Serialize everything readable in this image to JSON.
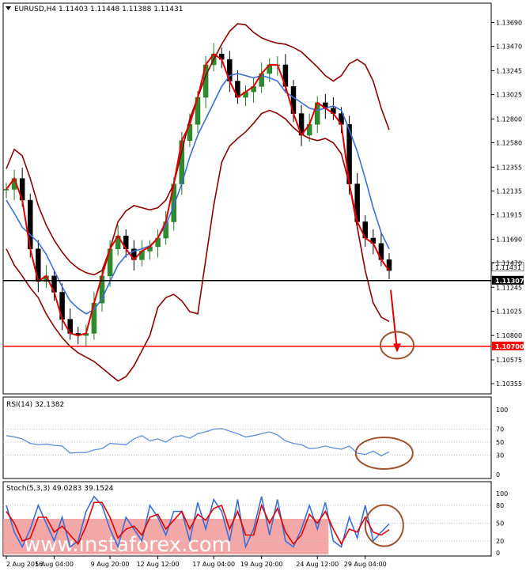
{
  "main_header": "EURUSD,H4  1.11403 1.11448 1.11388 1.11431",
  "rsi_header": "RSI(14) 32.1382",
  "stoch_header": "Stoch(5,3,3) 49.0283 39.1524",
  "watermark": "www.instaforex.com",
  "chart_data": [
    {
      "type": "line",
      "panel": "price",
      "symbol": "EURUSD",
      "timeframe": "H4",
      "ohlc": {
        "open": 1.11403,
        "high": 1.11448,
        "low": 1.11388,
        "close": 1.11431
      },
      "y_ticks": [
        "1.13690",
        "1.13470",
        "1.13245",
        "1.13025",
        "1.12800",
        "1.12580",
        "1.12355",
        "1.12135",
        "1.11915",
        "1.11690",
        "1.11470",
        "1.11245",
        "1.11025",
        "1.10800",
        "1.10575",
        "1.10355"
      ],
      "ylim": [
        1.1029,
        1.1376
      ],
      "x_ticks": [
        "2 Aug 2016",
        "5 Aug 04:00",
        "9 Aug 20:00",
        "12 Aug 12:00",
        "17 Aug 04:00",
        "19 Aug 20:00",
        "24 Aug 12:00",
        "29 Aug 04:00"
      ],
      "horizontal_lines": [
        {
          "value": 1.11307,
          "label": "1.11307",
          "color": "#000000"
        },
        {
          "value": 1.107,
          "label": "1.10700",
          "color": "#ff0000"
        }
      ],
      "current_price": {
        "value": 1.11431,
        "label": "1.11431"
      },
      "series": [
        {
          "role": "bollinger-upper",
          "color": "#8b0000",
          "values": [
            1.1234,
            1.1252,
            1.1246,
            1.1225,
            1.12,
            1.1182,
            1.1168,
            1.1157,
            1.1148,
            1.1142,
            1.1138,
            1.1136,
            1.114,
            1.116,
            1.1185,
            1.1195,
            1.12,
            1.1198,
            1.1196,
            1.1198,
            1.1205,
            1.122,
            1.125,
            1.128,
            1.13,
            1.132,
            1.1335,
            1.1349,
            1.1361,
            1.1368,
            1.1367,
            1.136,
            1.1355,
            1.1352,
            1.135,
            1.1349,
            1.1346,
            1.1342,
            1.1335,
            1.1328,
            1.132,
            1.1315,
            1.132,
            1.1331,
            1.1335,
            1.133,
            1.1315,
            1.129,
            1.127
          ]
        },
        {
          "role": "bollinger-middle",
          "color": "#3a6fd8",
          "values": [
            1.1205,
            1.1193,
            1.118,
            1.1173,
            1.1166,
            1.1155,
            1.114,
            1.1125,
            1.1112,
            1.1105,
            1.11,
            1.1104,
            1.1114,
            1.113,
            1.1145,
            1.1154,
            1.1158,
            1.116,
            1.1163,
            1.117,
            1.1182,
            1.12,
            1.122,
            1.1245,
            1.1265,
            1.128,
            1.1295,
            1.131,
            1.132,
            1.1322,
            1.132,
            1.1318,
            1.132,
            1.1318,
            1.1315,
            1.1305,
            1.13,
            1.1295,
            1.129,
            1.1288,
            1.129,
            1.1292,
            1.1288,
            1.127,
            1.125,
            1.1225,
            1.1198,
            1.1175,
            1.116
          ]
        },
        {
          "role": "bollinger-lower",
          "color": "#8b0000",
          "values": [
            1.116,
            1.1145,
            1.1135,
            1.1124,
            1.1115,
            1.11,
            1.1088,
            1.1078,
            1.107,
            1.1064,
            1.106,
            1.1056,
            1.105,
            1.1044,
            1.1038,
            1.1042,
            1.1052,
            1.1066,
            1.108,
            1.1106,
            1.1115,
            1.1118,
            1.1112,
            1.1102,
            1.11,
            1.115,
            1.12,
            1.124,
            1.1255,
            1.1262,
            1.1268,
            1.1276,
            1.1285,
            1.1288,
            1.1285,
            1.128,
            1.1272,
            1.1266,
            1.1262,
            1.126,
            1.1262,
            1.1258,
            1.1248,
            1.122,
            1.118,
            1.114,
            1.111,
            1.1097,
            1.1093
          ]
        },
        {
          "role": "moving-average",
          "color": "#e00000",
          "values": [
            1.1215,
            1.1225,
            1.1205,
            1.116,
            1.113,
            1.1135,
            1.112,
            1.1095,
            1.1082,
            1.108,
            1.1082,
            1.111,
            1.1135,
            1.116,
            1.1172,
            1.116,
            1.115,
            1.1158,
            1.1162,
            1.117,
            1.1185,
            1.122,
            1.126,
            1.1275,
            1.13,
            1.133,
            1.134,
            1.1335,
            1.1315,
            1.13,
            1.1305,
            1.131,
            1.1322,
            1.133,
            1.133,
            1.131,
            1.1285,
            1.1265,
            1.1275,
            1.1295,
            1.129,
            1.1285,
            1.1275,
            1.122,
            1.1185,
            1.117,
            1.1165,
            1.115,
            1.114
          ]
        },
        {
          "role": "forecast-arrow",
          "color": "#e00000",
          "from": {
            "index": 48,
            "value": 1.1122
          },
          "to": {
            "index": 49,
            "value": 1.1066
          }
        }
      ]
    },
    {
      "type": "line",
      "panel": "rsi",
      "name": "RSI(14)",
      "value": 32.1382,
      "ylim": [
        0,
        100
      ],
      "y_ticks": [
        100,
        70,
        50,
        30,
        0
      ],
      "color": "#5b8fd6",
      "values": [
        60,
        58,
        55,
        48,
        46,
        47,
        45,
        44,
        33,
        34,
        34,
        38,
        40,
        48,
        47,
        46,
        55,
        60,
        52,
        55,
        50,
        58,
        60,
        56,
        63,
        66,
        70,
        71,
        67,
        63,
        58,
        60,
        63,
        66,
        61,
        52,
        48,
        46,
        40,
        41,
        44,
        41,
        39,
        44,
        33,
        31,
        36,
        29,
        35
      ]
    },
    {
      "type": "line",
      "panel": "stochastic",
      "name": "Stoch(5,3,3)",
      "main_value": 49.0283,
      "signal_value": 39.1524,
      "ylim": [
        0,
        100
      ],
      "y_ticks": [
        100,
        80,
        50,
        20,
        0
      ],
      "series": [
        {
          "role": "main",
          "color": "#3a6fd8",
          "values": [
            80,
            35,
            10,
            40,
            80,
            50,
            20,
            60,
            10,
            20,
            70,
            95,
            80,
            40,
            10,
            60,
            40,
            20,
            80,
            60,
            30,
            70,
            70,
            20,
            85,
            40,
            90,
            70,
            20,
            90,
            10,
            40,
            95,
            30,
            90,
            20,
            10,
            40,
            80,
            40,
            85,
            20,
            10,
            60,
            25,
            80,
            20,
            35,
            49
          ]
        },
        {
          "role": "signal",
          "color": "#e00000",
          "values": [
            70,
            50,
            20,
            25,
            60,
            60,
            35,
            45,
            30,
            15,
            45,
            85,
            85,
            60,
            25,
            40,
            45,
            30,
            60,
            65,
            40,
            55,
            70,
            40,
            65,
            55,
            75,
            80,
            40,
            70,
            30,
            30,
            80,
            50,
            75,
            35,
            15,
            30,
            65,
            50,
            70,
            40,
            15,
            40,
            35,
            60,
            35,
            30,
            39
          ]
        }
      ],
      "highlight": {
        "from": 0,
        "to": 40,
        "color": "#f08a8a"
      }
    }
  ],
  "annotations": [
    {
      "type": "ellipse",
      "panel": "price",
      "color": "#a0522d",
      "center_index": 48,
      "center_value": 1.1071
    },
    {
      "type": "ellipse",
      "panel": "rsi",
      "color": "#a0522d",
      "center_index": 46,
      "center_value": 33
    },
    {
      "type": "ellipse",
      "panel": "stochastic",
      "color": "#a0522d",
      "center_index": 46,
      "center_value": 46
    }
  ]
}
